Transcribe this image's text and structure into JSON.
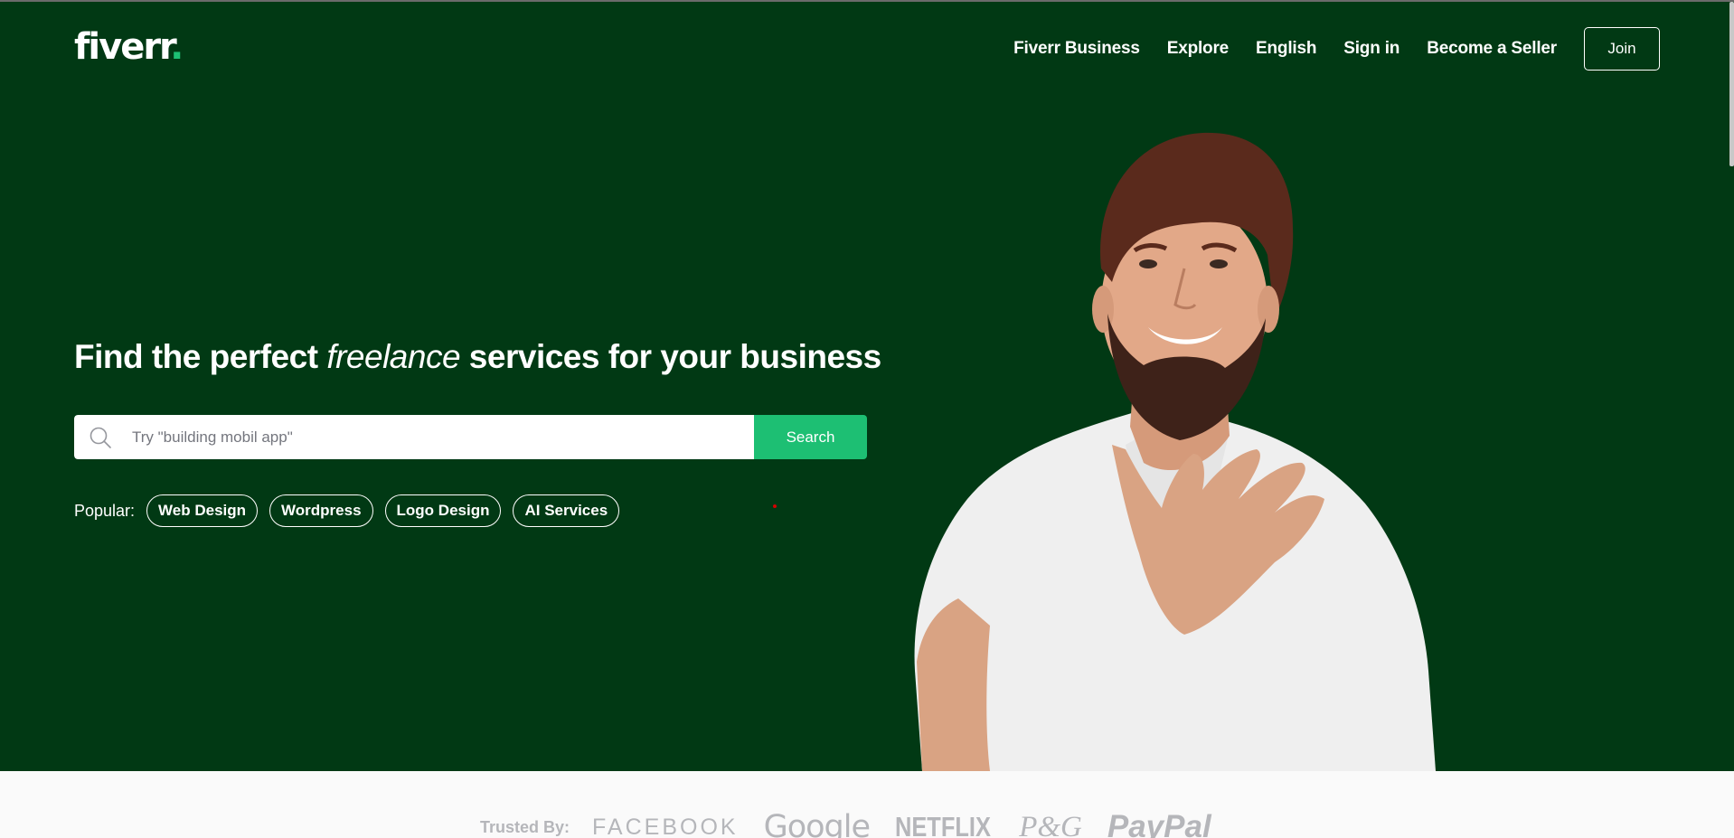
{
  "header": {
    "logo_text": "fiverr",
    "logo_dot": ".",
    "nav": [
      {
        "label": "Fiverr Business"
      },
      {
        "label": "Explore"
      },
      {
        "label": "English"
      },
      {
        "label": "Sign in"
      },
      {
        "label": "Become a Seller"
      }
    ],
    "join_label": "Join"
  },
  "hero": {
    "headline_part1": "Find the perfect ",
    "headline_em": "freelance",
    "headline_part2": " services for your business",
    "search": {
      "placeholder": "Try \"building mobil app\"",
      "button_label": "Search"
    },
    "popular_label": "Popular:",
    "popular_tags": [
      "Web Design",
      "Wordpress",
      "Logo Design",
      "AI Services"
    ]
  },
  "trusted": {
    "label": "Trusted By:",
    "brands": [
      "FACEBOOK",
      "Google",
      "NETFLIX",
      "P&G",
      "PayPal"
    ]
  },
  "colors": {
    "hero_bg": "#013914",
    "accent": "#1dbf73",
    "logo_dot": "#1dbf73",
    "trusted_bg": "#fafafa",
    "brand_gray": "#b5b6ba"
  }
}
